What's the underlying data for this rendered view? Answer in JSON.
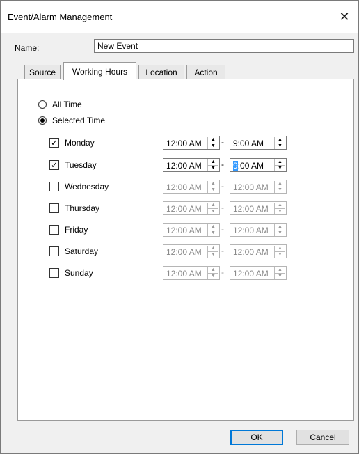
{
  "window": {
    "title": "Event/Alarm Management",
    "close": "✕"
  },
  "name": {
    "label": "Name:",
    "value": "New Event"
  },
  "tabs": [
    "Source",
    "Working Hours",
    "Location",
    "Action"
  ],
  "active_tab": "Working Hours",
  "mode": {
    "options": [
      {
        "label": "All Time",
        "checked": false
      },
      {
        "label": "Selected Time",
        "checked": true
      }
    ]
  },
  "days": [
    {
      "label": "Monday",
      "checked": true,
      "start": "12:00 AM",
      "end": "9:00 AM",
      "enabled": true
    },
    {
      "label": "Tuesday",
      "checked": true,
      "start": "12:00 AM",
      "end": "9:00 AM",
      "enabled": true
    },
    {
      "label": "Wednesday",
      "checked": false,
      "start": "12:00 AM",
      "end": "12:00 AM",
      "enabled": false
    },
    {
      "label": "Thursday",
      "checked": false,
      "start": "12:00 AM",
      "end": "12:00 AM",
      "enabled": false
    },
    {
      "label": "Friday",
      "checked": false,
      "start": "12:00 AM",
      "end": "12:00 AM",
      "enabled": false
    },
    {
      "label": "Saturday",
      "checked": false,
      "start": "12:00 AM",
      "end": "12:00 AM",
      "enabled": false
    },
    {
      "label": "Sunday",
      "checked": false,
      "start": "12:00 AM",
      "end": "12:00 AM",
      "enabled": false
    }
  ],
  "separator": "-",
  "buttons": {
    "ok": "OK",
    "cancel": "Cancel"
  },
  "colors": {
    "focus_border": "#0078d7",
    "selection": "#3399ff"
  }
}
